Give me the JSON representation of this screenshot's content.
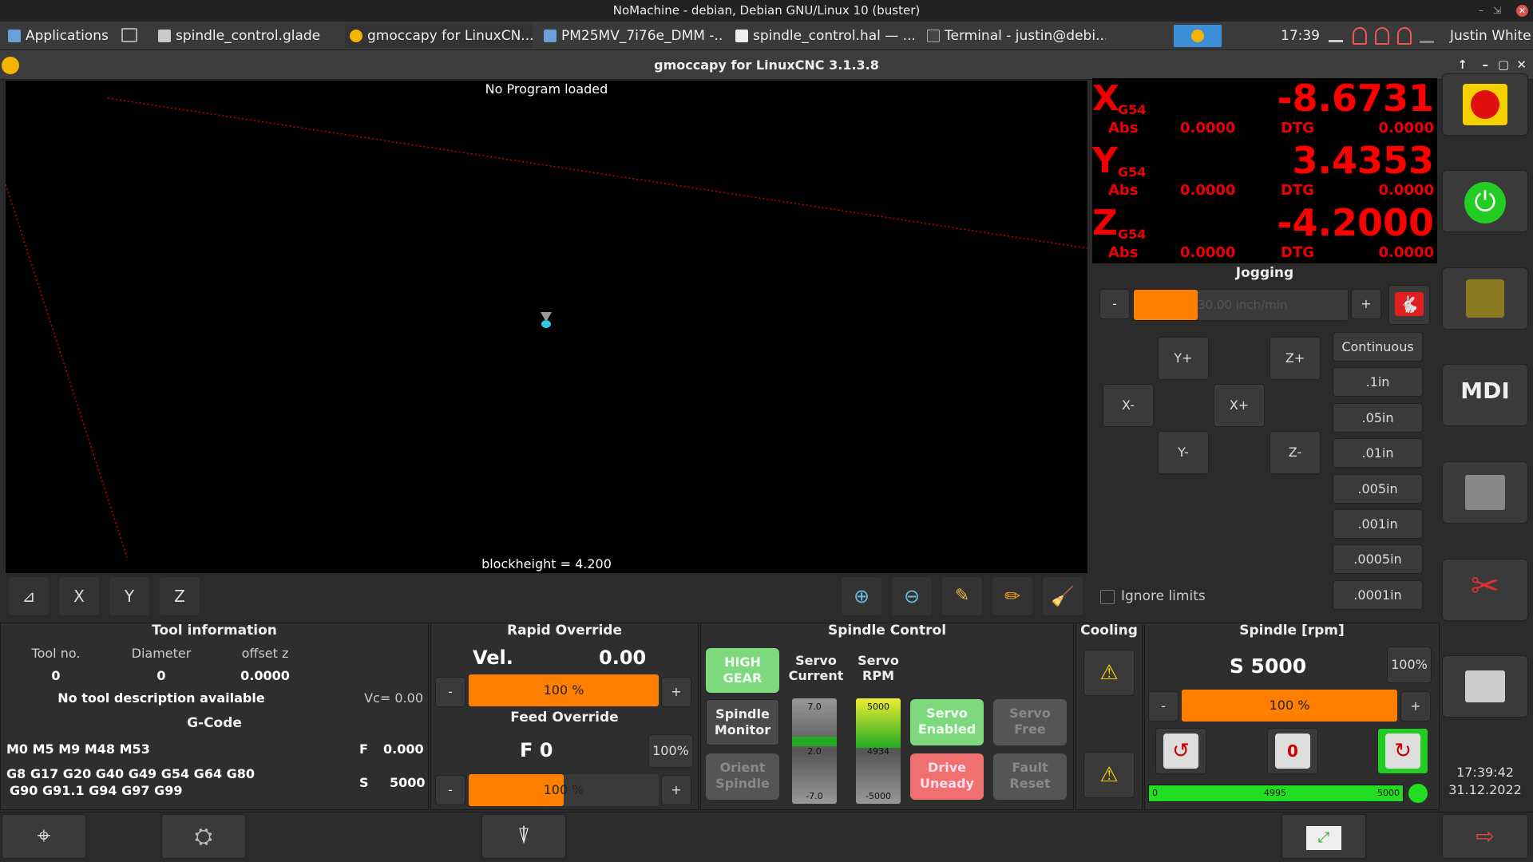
{
  "nomachine": {
    "title": "NoMachine - debian, Debian GNU/Linux 10 (buster)"
  },
  "panel": {
    "applications": "Applications",
    "tasks": [
      "spindle_control.glade",
      "gmoccapy for LinuxCN...",
      "PM25MV_7i76e_DMM -...",
      "spindle_control.hal — ...",
      "Terminal - justin@debi..."
    ],
    "clock": "17:39",
    "user": "Justin White"
  },
  "window": {
    "title": "gmoccapy for LinuxCNC  3.1.3.8"
  },
  "plot": {
    "program": "No Program loaded",
    "blockheight": "blockheight = 4.200"
  },
  "dro": {
    "x": {
      "label": "X",
      "coord": "G54",
      "value": "-8.6731",
      "abs_label": "Abs",
      "abs": "0.0000",
      "dtg_label": "DTG",
      "dtg": "0.0000"
    },
    "y": {
      "label": "Y",
      "coord": "G54",
      "value": "3.4353",
      "abs_label": "Abs",
      "abs": "0.0000",
      "dtg_label": "DTG",
      "dtg": "0.0000"
    },
    "z": {
      "label": "Z",
      "coord": "G54",
      "value": "-4.2000",
      "abs_label": "Abs",
      "abs": "0.0000",
      "dtg_label": "DTG",
      "dtg": "0.0000"
    }
  },
  "jogging": {
    "title": "Jogging",
    "minus": "-",
    "plus": "+",
    "speed": "30.00 inch/min",
    "speed_fraction": 0.3,
    "buttons": {
      "yplus": "Y+",
      "zplus": "Z+",
      "xminus": "X-",
      "xplus": "X+",
      "yminus": "Y-",
      "zminus": "Z-"
    },
    "increments": [
      "Continuous",
      ".1in",
      ".05in",
      ".01in",
      ".005in",
      ".001in",
      ".0005in",
      ".0001in"
    ],
    "ignore_limits": "Ignore limits"
  },
  "tool": {
    "title": "Tool information",
    "col_no": "Tool no.",
    "col_dia": "Diameter",
    "col_off": "offset z",
    "no": "0",
    "dia": "0",
    "off": "0.0000",
    "desc": "No tool description available",
    "vc": "Vc= 0.00"
  },
  "gcode": {
    "title": "G-Code",
    "mcodes": "M0 M5 M9 M48 M53",
    "f_label": "F",
    "f": "0.000",
    "gcodes1": "G8 G17 G20 G40 G49 G54 G64 G80",
    "gcodes2": "G90 G91.1 G94 G97 G99",
    "s_label": "S",
    "s": "5000"
  },
  "rapid": {
    "title": "Rapid Override",
    "vel_label": "Vel.",
    "vel": "0.00",
    "pct": "100 %",
    "minus": "-",
    "plus": "+",
    "fraction": 1.0
  },
  "feed": {
    "title": "Feed Override",
    "f": "F  0",
    "pct": "100 %",
    "reset": "100%",
    "minus": "-",
    "plus": "+",
    "fraction": 0.5
  },
  "spindle_control": {
    "title": "Spindle Control",
    "high_gear": "HIGH\nGEAR",
    "servo_current": "Servo\nCurrent",
    "servo_rpm": "Servo\nRPM",
    "spindle_monitor": "Spindle\nMonitor",
    "orient": "Orient\nSpindle",
    "servo_enabled": "Servo\nEnabled",
    "servo_free": "Servo\nFree",
    "drive_ready": "Drive\nUneady",
    "fault_reset": "Fault\nReset",
    "current_top": "7.0",
    "current_mid": "2.0",
    "current_bot": "-7.0",
    "rpm_top": "5000",
    "rpm_mid": "4934",
    "rpm_bot": "-5000"
  },
  "cooling": {
    "title": "Cooling"
  },
  "spindle": {
    "title": "Spindle [rpm]",
    "s": "S 5000",
    "pct_btn": "100%",
    "pct": "100 %",
    "minus": "-",
    "plus": "+",
    "bar_min": "0",
    "bar_val": "4995",
    "bar_max": "5000"
  },
  "clock": {
    "time": "17:39:42",
    "date": "31.12.2022"
  },
  "colors": {
    "accent": "#ff8000",
    "dro": "#ff0000",
    "green": "#22cc22"
  }
}
